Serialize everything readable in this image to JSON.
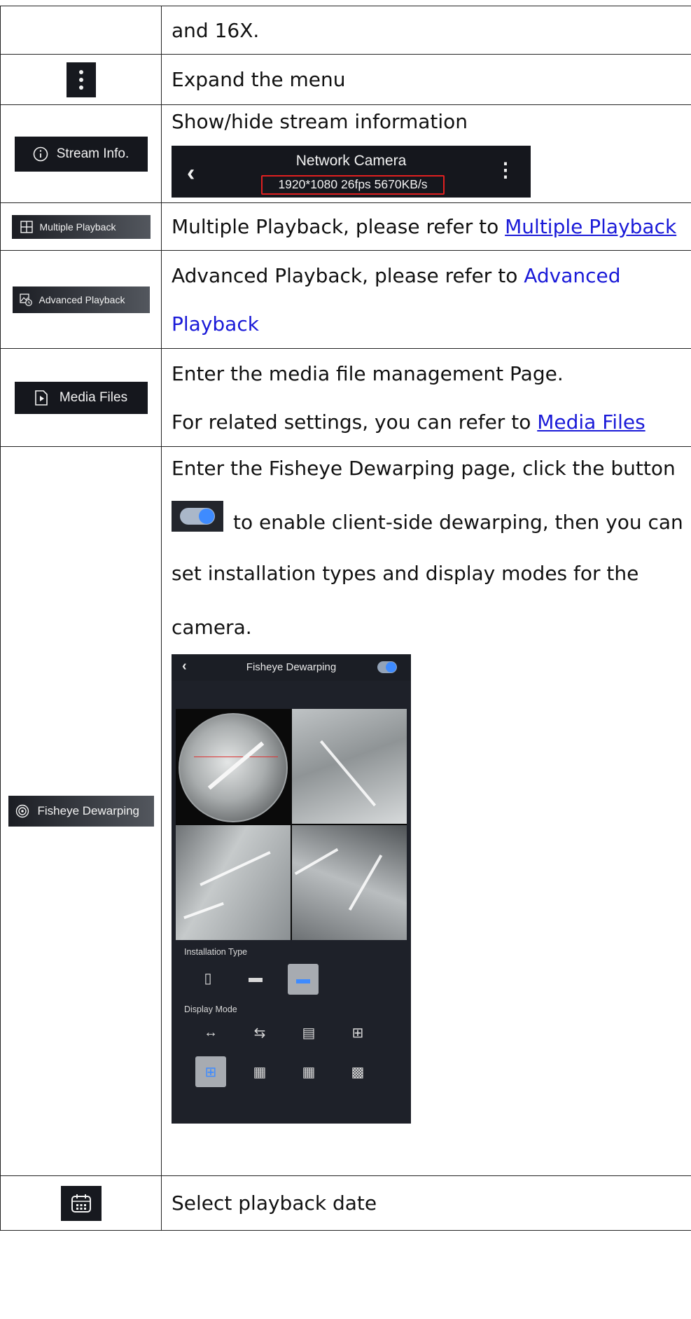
{
  "rows": {
    "zoom": {
      "text": "and 16X."
    },
    "expand": {
      "icon": "vertical-dots-icon",
      "text": "Expand the menu"
    },
    "stream": {
      "button_label": "Stream Info.",
      "icon": "info-circle-icon",
      "text": "Show/hide stream information",
      "preview": {
        "title": "Network Camera",
        "stats": "1920*1080  26fps  5670KB/s"
      }
    },
    "multiple": {
      "button_label": "Multiple Playback",
      "icon": "grid-square-icon",
      "text": "Multiple Playback, please refer to ",
      "link": "Multiple Playback"
    },
    "advanced": {
      "button_label": "Advanced Playback",
      "icon": "image-clock-icon",
      "text": "Advanced Playback, please refer to ",
      "link_part1": "Advanced",
      "link_part2": "Playback"
    },
    "media": {
      "button_label": "Media Files",
      "icon": "file-play-icon",
      "line1": "Enter the media file management Page.",
      "line2_text": "For related settings, you can refer to ",
      "line2_link": "Media Files"
    },
    "fisheye": {
      "button_label": "Fisheye Dewarping",
      "icon": "target-circle-icon",
      "line1": "Enter the Fisheye Dewarping page, click the button",
      "line2": "to enable client-side dewarping, then you can",
      "line3": "set installation types and display modes for the",
      "line4": "camera.",
      "phone": {
        "title": "Fisheye Dewarping",
        "install_label": "Installation Type",
        "display_label": "Display Mode"
      }
    },
    "date": {
      "icon": "calendar-icon",
      "text": "Select playback date"
    }
  }
}
